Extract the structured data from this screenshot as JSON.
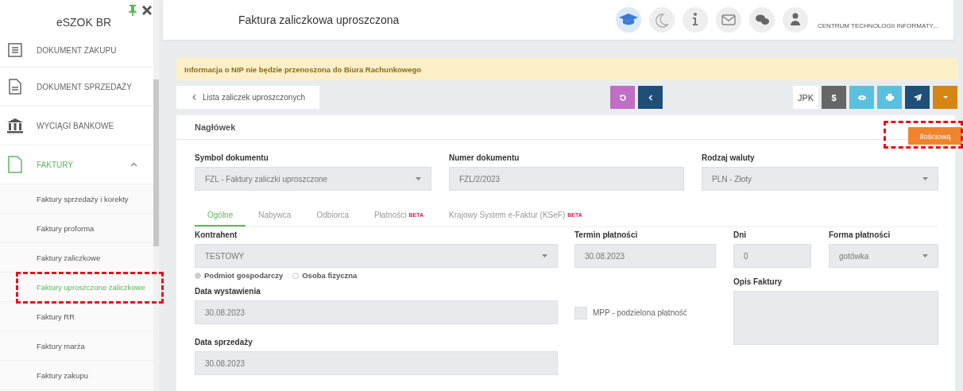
{
  "sidebar": {
    "title": "eSZOK BR",
    "items": [
      {
        "label": "DOKUMENT ZAKUPU",
        "selected": false
      },
      {
        "label": "DOKUMENT SPRZEDAŻY",
        "selected": false
      },
      {
        "label": "WYCIĄGI BANKOWE",
        "selected": false
      },
      {
        "label": "FAKTURY",
        "selected": true,
        "expanded": true,
        "children": [
          {
            "label": "Faktury sprzedaży i korekty",
            "selected": false
          },
          {
            "label": "Faktury proforma",
            "selected": false
          },
          {
            "label": "Faktury zaliczkowe",
            "selected": false
          },
          {
            "label": "Faktury uproszczone zaliczkowe",
            "selected": true
          },
          {
            "label": "Faktury RR",
            "selected": false
          },
          {
            "label": "Faktury marża",
            "selected": false
          },
          {
            "label": "Faktury zakupu",
            "selected": false
          }
        ]
      }
    ]
  },
  "header": {
    "title": "Faktura zaliczkowa uproszczona",
    "company": "CENTRUM TECHNOLOGII INFORMATY..."
  },
  "banner": "Informacja o NIP nie będzie przenoszona do Biura Rachunkowego",
  "toolbar": {
    "back": "Lista zaliczek uproszczonych",
    "jpk": "JPK",
    "currency": "$",
    "menu": {
      "item": "Ilościową"
    }
  },
  "card": {
    "title": "Nagłówek",
    "top_fields": [
      {
        "label": "Symbol dokumentu",
        "value": "FZL - Faktury zaliczki uproszczone",
        "kind": "select"
      },
      {
        "label": "Numer dokumentu",
        "value": "FZL/2/2023",
        "kind": "input"
      },
      {
        "label": "Rodzaj waluty",
        "value": "PLN - Złoty",
        "kind": "select"
      }
    ],
    "tabs": [
      {
        "label": "Ogólne",
        "selected": true
      },
      {
        "label": "Nabywca",
        "selected": false
      },
      {
        "label": "Odbiorca",
        "selected": false
      },
      {
        "label": "Płatności",
        "badge": "BETA",
        "selected": false
      },
      {
        "label": "Krajowy System e-Faktur (KSeF)",
        "badge": "BETA",
        "selected": false
      }
    ],
    "kontrahent": {
      "label": "Kontrahent",
      "value": "TESTOWY"
    },
    "radios": [
      {
        "label": "Podmiot gospodarczy",
        "selected": true
      },
      {
        "label": "Osoba fizyczna",
        "selected": false
      }
    ],
    "data_wystawienia": {
      "label": "Data wystawienia",
      "value": "30.08.2023"
    },
    "data_sprzedazy": {
      "label": "Data sprzedaży",
      "value": "30.08.2023"
    },
    "termin": {
      "label": "Termin płatności",
      "value": "30.08.2023"
    },
    "dni": {
      "label": "Dni",
      "value": "0"
    },
    "forma": {
      "label": "Forma płatności",
      "value": "gotówka"
    },
    "mpp": {
      "label": "MPP - podzielona płatność",
      "checked": false
    },
    "opis": {
      "label": "Opis Faktury"
    }
  }
}
